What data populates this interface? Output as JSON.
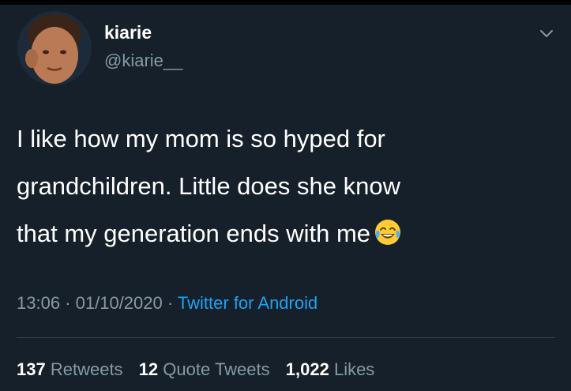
{
  "tweet": {
    "author": {
      "display_name": "kiarie",
      "handle": "@kiarie__"
    },
    "text_lines": [
      "I like how my mom is so hyped for",
      "grandchildren. Little does she know",
      "that my generation ends with me"
    ],
    "emoji_icon": "face-with-tears-of-joy-icon",
    "time": "13:06",
    "separator": "·",
    "date": "01/10/2020",
    "source": "Twitter for Android",
    "stats": {
      "retweets_count": "137",
      "retweets_label": "Retweets",
      "quotes_count": "12",
      "quotes_label": "Quote Tweets",
      "likes_count": "1,022",
      "likes_label": "Likes"
    }
  },
  "colors": {
    "background": "#15202b",
    "text_primary": "#ffffff",
    "text_secondary": "#8899a6",
    "link": "#1da1f2",
    "divider": "#38444d"
  }
}
